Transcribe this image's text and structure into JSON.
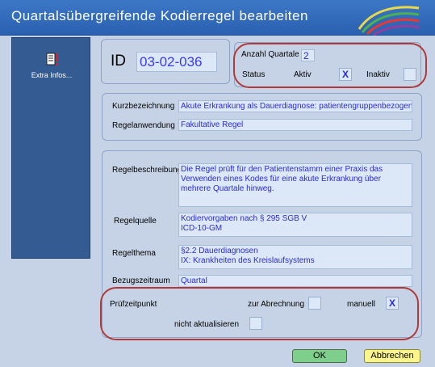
{
  "window": {
    "title": "Quartalsübergreifende Kodierregel bearbeiten"
  },
  "sidebar": {
    "items": [
      {
        "label": "Extra Infos...",
        "icon": "document-warning-icon"
      }
    ]
  },
  "header": {
    "id_label": "ID",
    "id_value": "03-02-036"
  },
  "quartale": {
    "anzahl_label": "Anzahl Quartale",
    "anzahl_value": "2",
    "status_label": "Status",
    "aktiv_label": "Aktiv",
    "aktiv_checked": "X",
    "inaktiv_label": "Inaktiv",
    "inaktiv_checked": ""
  },
  "kurz": {
    "kurzbezeichnung_label": "Kurzbezeichnung",
    "kurzbezeichnung_value": "Akute Erkrankung als Dauerdiagnose: patientengruppenbezogene P",
    "regelanwendung_label": "Regelanwendung",
    "regelanwendung_value": "Fakultative Regel"
  },
  "regel": {
    "beschreibung_label": "Regelbeschreibung",
    "beschreibung_value": "Die Regel prüft für den Patientenstamm einer Praxis das Verwenden eines Kodes für eine akute Erkrankung über mehrere Quartale hinweg.",
    "quelle_label": "Regelquelle",
    "quelle_line1": "Kodiervorgaben nach § 295 SGB V",
    "quelle_line2": "ICD-10-GM",
    "thema_label": "Regelthema",
    "thema_line1": "§2.2 Dauerdiagnosen",
    "thema_line2": "IX: Krankheiten des Kreislaufsystems",
    "bezugszeitraum_label": "Bezugszeitraum",
    "bezugszeitraum_value": "Quartal"
  },
  "pruefzeitpunkt": {
    "label": "Prüfzeitpunkt",
    "abrechnung_label": "zur Abrechnung",
    "abrechnung_checked": "",
    "manuell_label": "manuell",
    "manuell_checked": "X",
    "nicht_akt_label": "nicht aktualisieren",
    "nicht_akt_checked": ""
  },
  "buttons": {
    "ok_label": "OK",
    "cancel_label": "Abbrechen"
  },
  "colors": {
    "title_bar": "#2f69b8",
    "sidebar": "#345c93",
    "background": "#c6d3e6",
    "field_text": "#2a2ad8",
    "annotation": "#b03a3a",
    "ok": "#7ecf8c",
    "cancel": "#fcf58e"
  }
}
